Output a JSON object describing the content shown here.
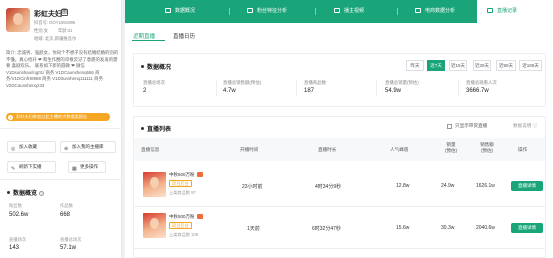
{
  "profile": {
    "name": "彩虹夫妇",
    "name_badge": "图",
    "id_line": "抖音号: DOY1981995",
    "gender": "性别:女",
    "age": "年龄:31",
    "region": "地域: 北京,新疆维吾尔",
    "bio": "简介: 忠诚男、强颜女，你同个不想子没有结婚结婚的别的不懂。真心给开 ❤ 和生作圈的邓根云记了意愿的发发的需要 喜剧欢乐。 联系如下新的圆微 ❤ 微信V1Dsunshao/ing01/ 商务 V1DCaunshenq666 商务/V1DCinfH8988 商务 V1D3unshenq111111 商务 V2DCaunshenq233",
    "warning": "彩虹夫妇参加过此主播的大数据类报告",
    "warning_icon": "!",
    "buttons": [
      {
        "icon": "gear-icon",
        "glyph": "◎",
        "label": "加入收藏"
      },
      {
        "icon": "user-add-icon",
        "glyph": "⊕",
        "label": "加入我的主播库"
      },
      {
        "icon": "edit-icon",
        "glyph": "✎",
        "label": "刷新下实播"
      },
      {
        "icon": "more-icon",
        "glyph": "▦",
        "label": "更多操作"
      }
    ],
    "data_title": "数据概览",
    "data_help": "?",
    "stats": [
      {
        "label": "粉丝数",
        "value": "502.6w"
      },
      {
        "label": "作品数",
        "value": "668"
      },
      {
        "label": "直播场次",
        "value": "143"
      },
      {
        "label": "直播总场次",
        "value": "57.1w"
      }
    ]
  },
  "tabs": [
    {
      "label": "数据概况",
      "active": false
    },
    {
      "label": "粉丝特征分析",
      "active": false
    },
    {
      "label": "播主视频",
      "active": false
    },
    {
      "label": "电商数据分析",
      "active": false
    },
    {
      "label": "直播记录",
      "active": true
    }
  ],
  "subtabs": [
    {
      "label": "近期直播",
      "active": true
    },
    {
      "label": "直播日历",
      "active": false
    }
  ],
  "overview": {
    "title": "数据概况",
    "ranges": [
      {
        "label": "昨天",
        "active": false
      },
      {
        "label": "近7天",
        "active": true
      },
      {
        "label": "近15天",
        "active": false
      },
      {
        "label": "近30天",
        "active": false
      },
      {
        "label": "近90天",
        "active": false
      },
      {
        "label": "近180天",
        "active": false
      }
    ],
    "metrics": [
      {
        "label": "直播总场次",
        "value": "2"
      },
      {
        "label": "直播总销售额(预估)",
        "value": "4.7w"
      },
      {
        "label": "直播商品数",
        "value": "187"
      },
      {
        "label": "直播总销量(预估)",
        "value": "54.9w"
      },
      {
        "label": "直播总观看人次",
        "value": "3666.7w"
      }
    ]
  },
  "list": {
    "title": "直播列表",
    "checkbox_label": "只显示带货直播",
    "download_label": "数据说明 ⓘ",
    "columns": [
      "直播信息",
      "开播时间",
      "直播时长",
      "人气峰值",
      "销量\n(预估)",
      "销售额\n(预估)",
      "操作"
    ],
    "rows": [
      {
        "title": "中秋500万粉",
        "tag": "项目后台",
        "sub": "上架商品数 97",
        "start": "23小时前",
        "duration": "4时34分9秒",
        "peak": "12.8w",
        "sales": "24.9w",
        "revenue": "1626.1w",
        "action": "直播详情"
      },
      {
        "title": "中秋500万粉",
        "tag": "项目后台",
        "sub": "上架商品数 108",
        "start": "1天前",
        "duration": "6时32分47秒",
        "peak": "15.6w",
        "sales": "30.3w",
        "revenue": "2040.6w",
        "action": "直播详情"
      }
    ]
  },
  "colors": {
    "brand": "#1aa47a",
    "warning": "#f5a623",
    "hot": "#f26b3a"
  }
}
